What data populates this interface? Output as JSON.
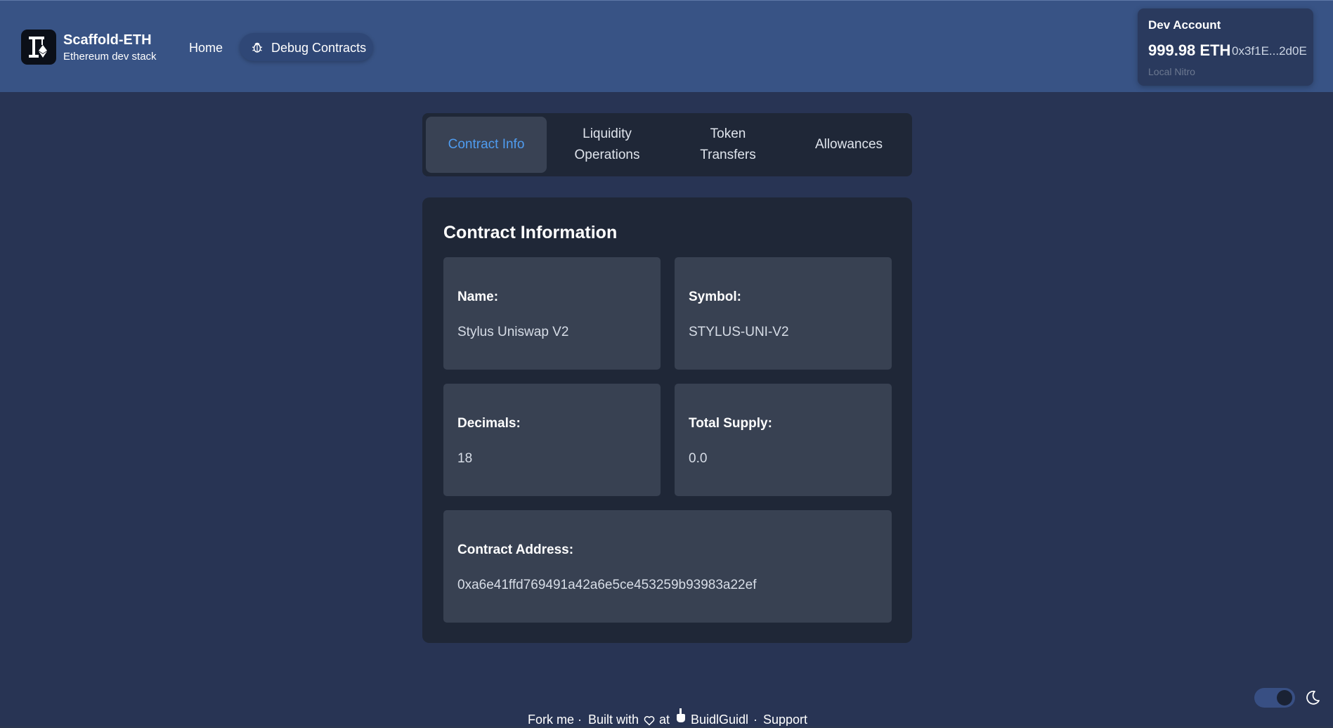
{
  "header": {
    "brand_name": "Scaffold-ETH",
    "brand_sub": "Ethereum dev stack",
    "nav_home": "Home",
    "nav_debug": "Debug Contracts"
  },
  "account": {
    "title": "Dev Account",
    "balance": "999.98 ETH",
    "address": "0x3f1E...2d0E",
    "network": "Local Nitro"
  },
  "tabs": [
    {
      "label": "Contract Info",
      "active": true
    },
    {
      "label": "Liquidity Operations",
      "active": false
    },
    {
      "label": "Token Transfers",
      "active": false
    },
    {
      "label": "Allowances",
      "active": false
    }
  ],
  "contract_info": {
    "title": "Contract Information",
    "name_label": "Name:",
    "name_value": "Stylus Uniswap V2",
    "symbol_label": "Symbol:",
    "symbol_value": "STYLUS-UNI-V2",
    "decimals_label": "Decimals:",
    "decimals_value": "18",
    "supply_label": "Total Supply:",
    "supply_value": "0.0",
    "address_label": "Contract Address:",
    "address_value": "0xa6e41ffd769491a42a6e5ce453259b93983a22ef"
  },
  "footer": {
    "fork": "Fork me",
    "sep": "·",
    "built_with": "Built with",
    "at": "at",
    "buidlguidl": "BuidlGuidl",
    "support": "Support"
  },
  "theme": {
    "dark_mode": true,
    "accent": "#4f9cf0",
    "header_bg": "#385385",
    "page_bg": "#283454"
  },
  "icons": {
    "logo": "crane-eth-logo",
    "debug": "bug-icon",
    "heart": "heart-icon",
    "buidlguidl": "shovel-hand-icon",
    "theme": "moon-icon"
  }
}
